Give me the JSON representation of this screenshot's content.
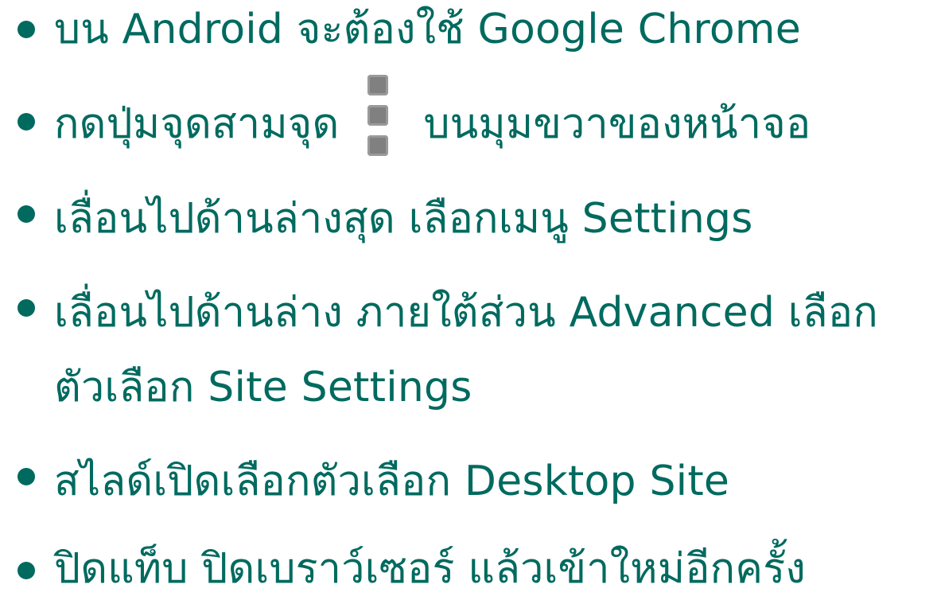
{
  "colors": {
    "text": "#006a5f",
    "icon": "#808080"
  },
  "steps": [
    {
      "text": "บน Android จะต้องใช้ Google Chrome"
    },
    {
      "before": "กดปุ่มจุดสามจุด",
      "icon": "three-dots-vertical-icon",
      "after": "บนมุมขวาของหน้าจอ"
    },
    {
      "text": "เลื่อนไปด้านล่างสุด เลือกเมนู Settings"
    },
    {
      "line1": "เลื่อนไปด้านล่าง ภายใต้ส่วน Advanced เลือก",
      "line2": "ตัวเลือก Site Settings"
    },
    {
      "text": "สไลด์เปิดเลือกตัวเลือก Desktop Site"
    },
    {
      "text": "ปิดแท็บ ปิดเบราว์เซอร์ แล้วเข้าใหม่อีกครั้ง"
    }
  ]
}
